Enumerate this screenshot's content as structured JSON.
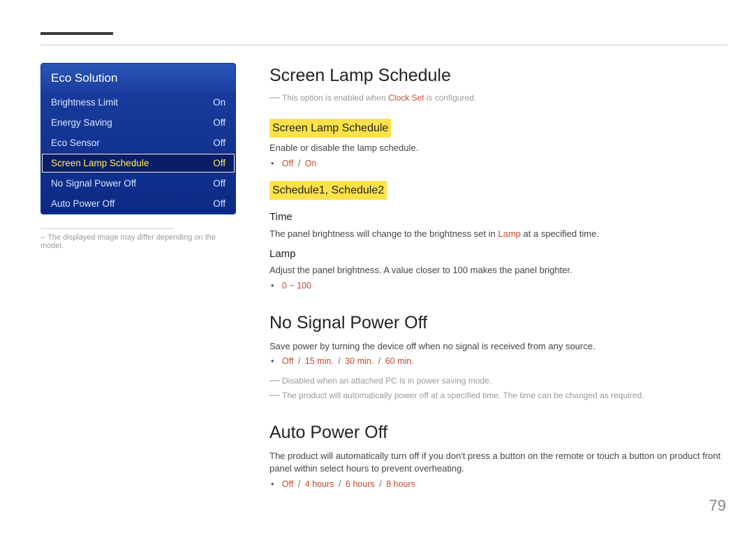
{
  "osd": {
    "title": "Eco Solution",
    "rows": [
      {
        "label": "Brightness Limit",
        "value": "On"
      },
      {
        "label": "Energy Saving",
        "value": "Off"
      },
      {
        "label": "Eco Sensor",
        "value": "Off"
      },
      {
        "label": "Screen Lamp Schedule",
        "value": "Off"
      },
      {
        "label": "No Signal Power Off",
        "value": "Off"
      },
      {
        "label": "Auto Power Off",
        "value": "Off"
      }
    ],
    "note_dash": "–",
    "note": "The displayed image may differ depending on the model."
  },
  "sections": {
    "sls_title": "Screen Lamp Schedule",
    "sls_note_dash": "―",
    "sls_note_pre": "This option is enabled when ",
    "sls_note_em": "Clock Set",
    "sls_note_post": " is configured.",
    "sls_sub": "Screen Lamp Schedule",
    "sls_desc": "Enable or disable the lamp schedule.",
    "sls_opt_off": "Off",
    "sls_opt_sep": "/",
    "sls_opt_on": "On",
    "sched_sub": "Schedule1, Schedule2",
    "time_h": "Time",
    "time_desc_pre": "The panel brightness will change to the brightness set in ",
    "time_desc_em": "Lamp",
    "time_desc_post": " at a specified time.",
    "lamp_h": "Lamp",
    "lamp_desc": "Adjust the panel brightness. A value closer to 100 makes the panel brighter.",
    "lamp_opt": "0 ~ 100",
    "nspo_title": "No Signal Power Off",
    "nspo_desc": "Save power by turning the device off when no signal is received from any source.",
    "nspo_o1": "Off",
    "nspo_o2": "15 min.",
    "nspo_o3": "30 min.",
    "nspo_o4": "60 min.",
    "nspo_note1": "Disabled when an attached PC is in power saving mode.",
    "nspo_note2": "The product will automatically power off at a specified time. The time can be changed as required.",
    "apo_title": "Auto Power Off",
    "apo_desc": "The product will automatically turn off if you don't press a button on the remote or touch a button on product front panel within select hours to prevent overheating.",
    "apo_o1": "Off",
    "apo_o2": "4 hours",
    "apo_o3": "6 hours",
    "apo_o4": "8 hours",
    "note_dash": "―"
  },
  "page_number": "79"
}
